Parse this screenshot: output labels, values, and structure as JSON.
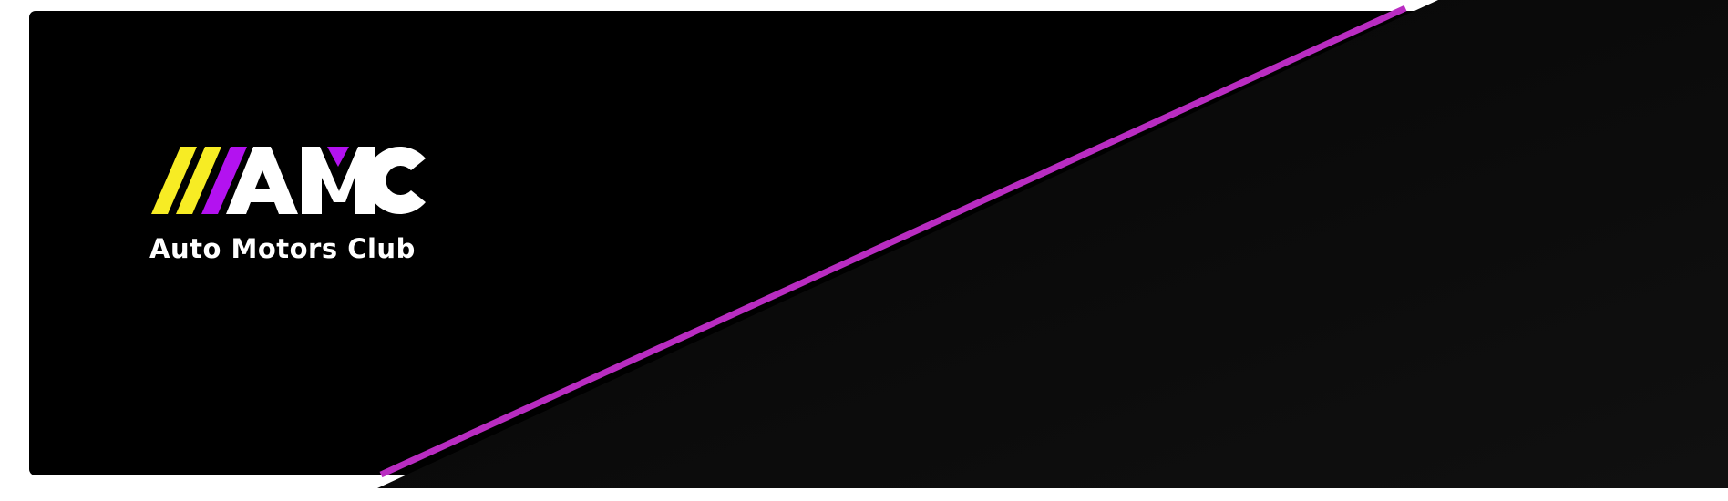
{
  "brand": {
    "logo_text": "AMC",
    "tagline": "Auto Motors Club",
    "logo_icon": "three-diagonal-stripes-icon"
  },
  "colors": {
    "card_background": "#000000",
    "dark_panel": "#0c0c0c",
    "accent_stripe": "#b92cc1",
    "logo_yellow": "#f7ec24",
    "logo_purple": "#b312f0",
    "logo_white": "#ffffff",
    "page_background": "#ffffff"
  }
}
